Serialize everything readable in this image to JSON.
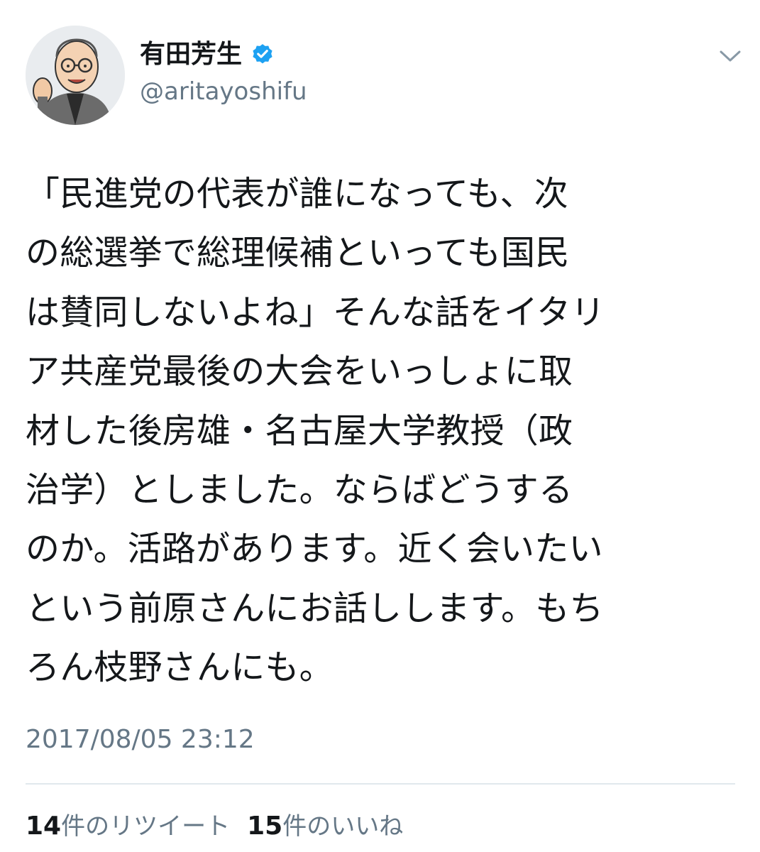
{
  "author": {
    "display_name": "有田芳生",
    "handle": "@aritayoshifu",
    "verified": true,
    "avatar_icon": "avatar-illustration",
    "verified_icon": "verified-badge-icon",
    "verified_color": "#1da1f2"
  },
  "menu": {
    "caret_icon": "chevron-down-icon"
  },
  "tweet": {
    "lines": [
      "「民進党の代表が誰になっても、次",
      "の総選挙で総理候補といっても国民",
      "は賛同しないよね」そんな話をイタリ",
      "ア共産党最後の大会をいっしょに取",
      "材した後房雄・名古屋大学教授（政",
      "治学）としました。ならばどうする",
      "のか。活路があります。近く会いたい",
      "という前原さんにお話しします。もち",
      "ろん枝野さんにも。"
    ],
    "timestamp": "2017/08/05 23:12"
  },
  "stats": {
    "retweet_count": "14",
    "retweet_label": "件のリツイート",
    "like_count": "15",
    "like_label": "件のいいね"
  },
  "colors": {
    "text": "#14171a",
    "secondary": "#657786",
    "divider": "#e1e8ed"
  }
}
